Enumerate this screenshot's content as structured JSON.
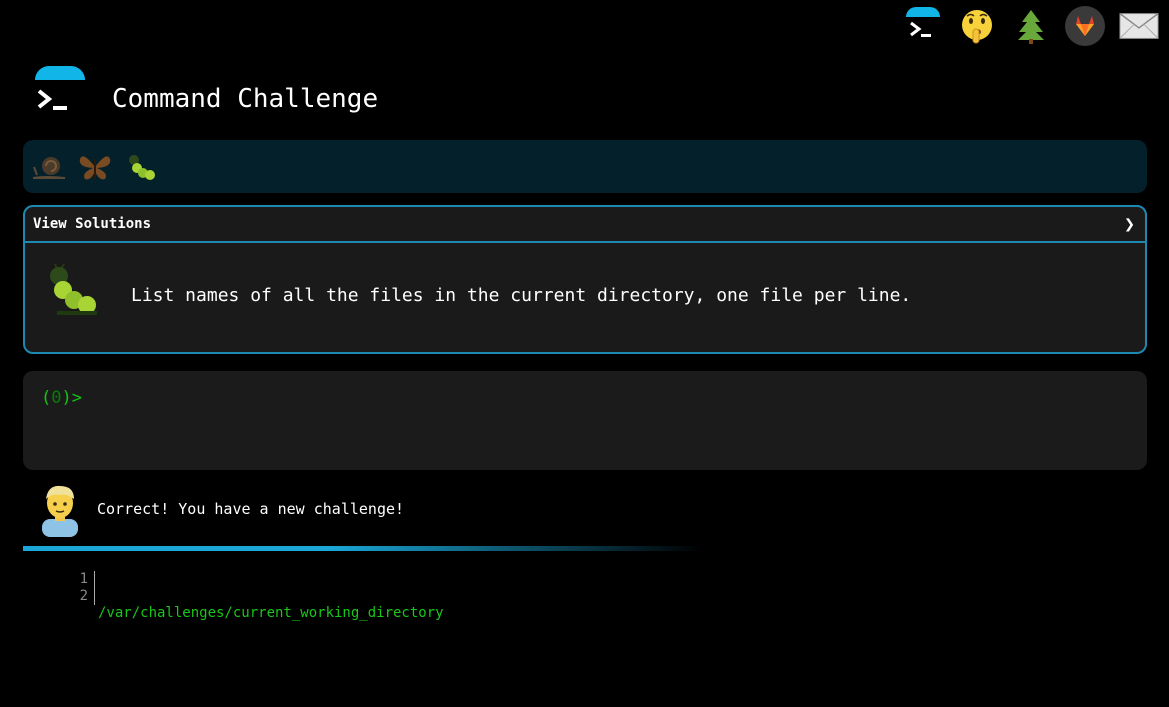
{
  "app": {
    "title": "Command Challenge"
  },
  "topbar": {
    "icons": [
      "terminal-logo-icon",
      "shushing-face-icon",
      "evergreen-tree-icon",
      "gitlab-icon",
      "envelope-icon"
    ]
  },
  "levels": [
    "snail-icon",
    "butterfly-icon",
    "caterpillar-icon"
  ],
  "card": {
    "header_label": "View Solutions",
    "chevron": "❯",
    "task_icon": "caterpillar-icon",
    "task": "List names of all the files in the current directory, one file per line."
  },
  "terminal": {
    "prompt_open": "(",
    "prompt_count": "0",
    "prompt_close": ")>",
    "value": ""
  },
  "feedback": {
    "avatar": "person-blond-icon",
    "message": "Correct! You have a new challenge!"
  },
  "editor": {
    "line_numbers": [
      "1",
      "2"
    ],
    "lines": [
      "/var/challenges/current_working_directory",
      ""
    ]
  },
  "colors": {
    "accent": "#1aa7d8",
    "prompt_green": "#11c611",
    "levels_bg": "#04212b",
    "card_border": "#1d89b0"
  }
}
